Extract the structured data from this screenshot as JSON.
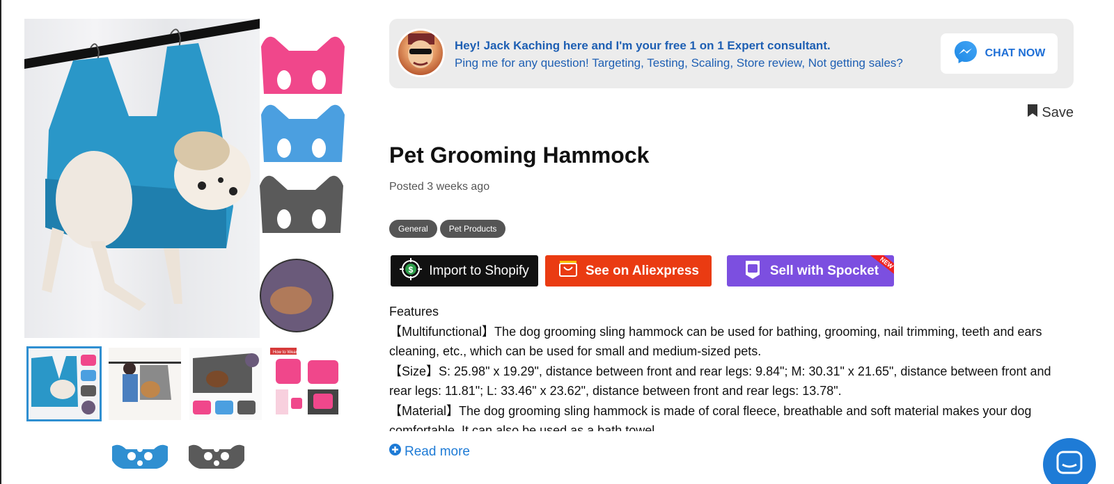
{
  "gallery": {
    "main_image_alt": "",
    "thumbnails": [
      {
        "label": ""
      },
      {
        "label": ""
      },
      {
        "label": ""
      },
      {
        "label": "How to Wear"
      }
    ]
  },
  "promo": {
    "line1": "Hey! Jack Kaching here and I'm your free 1 on 1 Expert consultant.",
    "line2": "Ping me for any question! Targeting, Testing, Scaling, Store review, Not getting sales?",
    "chat_label": "CHAT NOW"
  },
  "save_label": "Save",
  "product": {
    "title": "Pet Grooming Hammock",
    "posted": "Posted 3 weeks ago",
    "tags": [
      "General",
      "Pet Products"
    ]
  },
  "actions": {
    "shopify": "Import to Shopify",
    "aliexpress": "See on Aliexpress",
    "spocket": "Sell with Spocket",
    "spocket_badge": "NEW"
  },
  "features": {
    "heading": "Features",
    "paragraphs": [
      "【Multifunctional】The dog grooming sling hammock can be used for bathing, grooming, nail trimming, teeth and ears cleaning, etc., which can be used for small and medium-sized pets.",
      "【Size】S: 25.98\" x 19.29\", distance between front and rear legs: 9.84\"; M: 30.31\" x 21.65\", distance between front and rear legs: 11.81\"; L: 33.46\" x 23.62\", distance between front and rear legs: 13.78\".",
      "【Material】The dog grooming sling hammock is made of coral fleece, breathable and soft material makes your dog comfortable. It can also be used as a bath towel."
    ]
  },
  "read_more": "Read more",
  "colors": {
    "accent_blue": "#1e7bd6",
    "promo_text": "#1e5fb3",
    "aliexpress": "#ea3b12",
    "spocket": "#7c4fe0",
    "tag_bg": "#555555"
  }
}
